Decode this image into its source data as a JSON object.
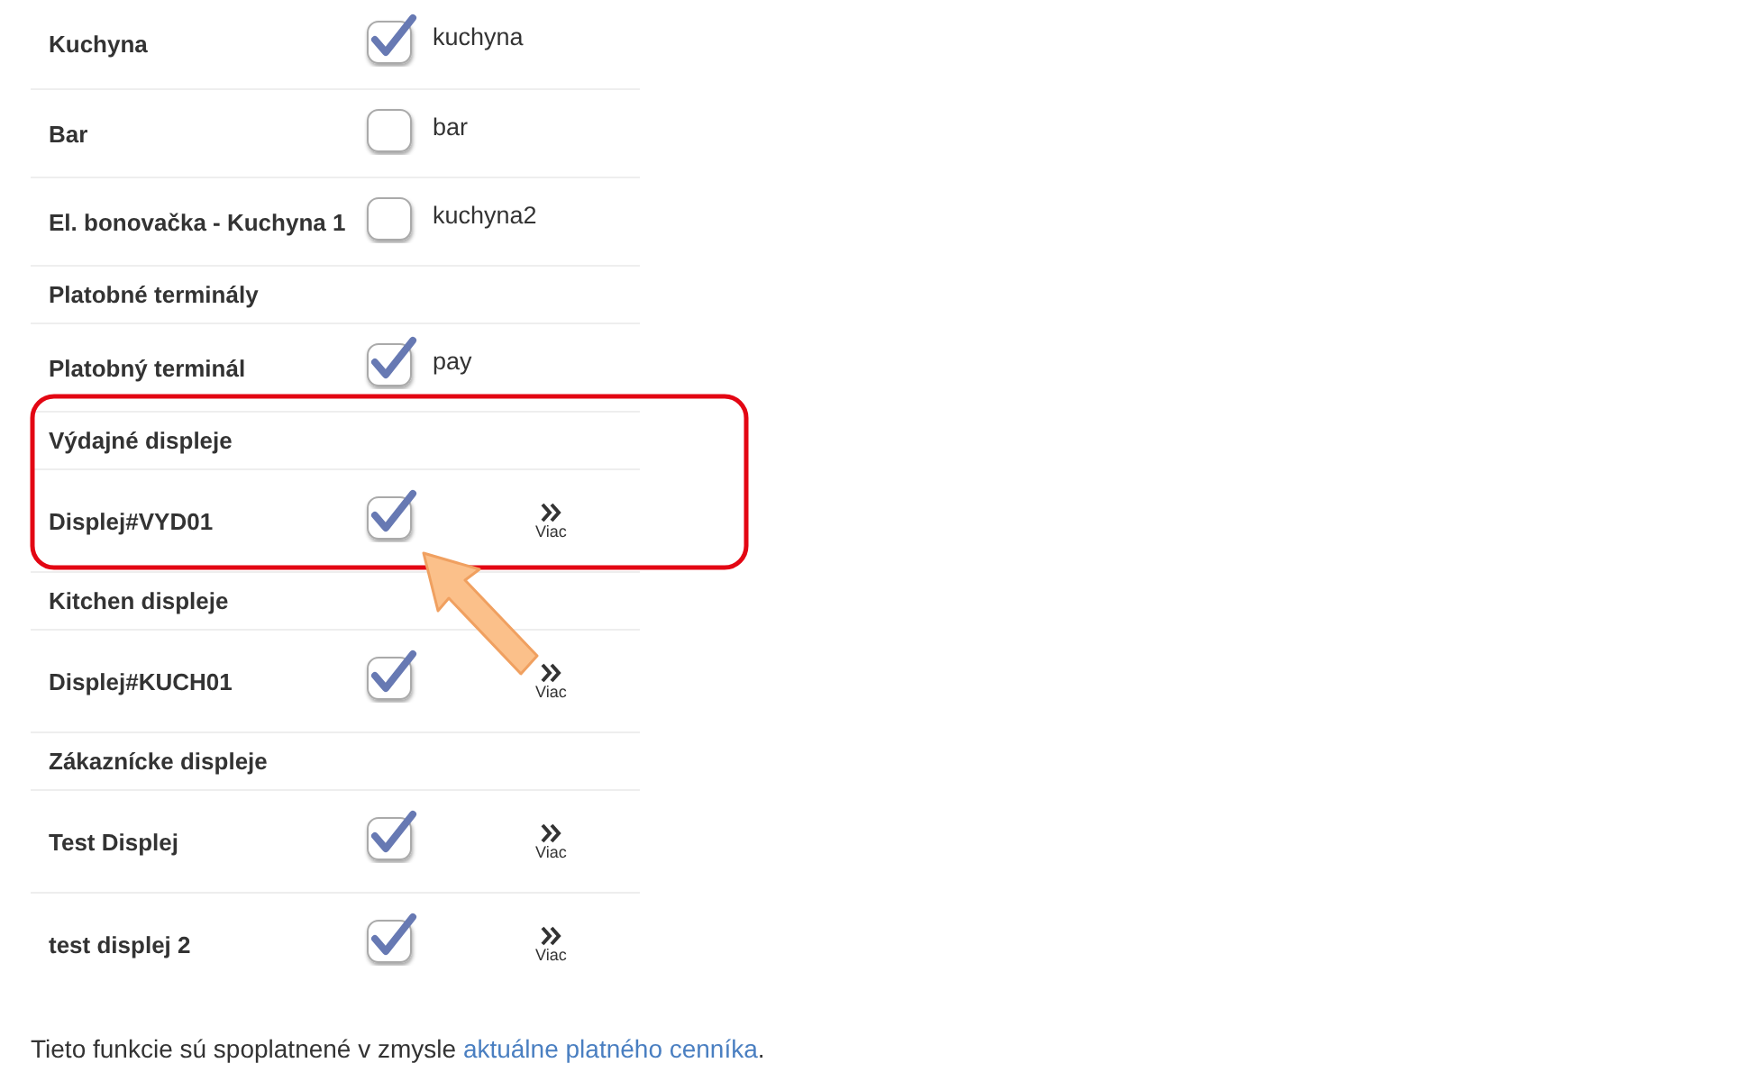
{
  "rows": [
    {
      "kind": "device",
      "label": "Kuchyna",
      "checked": true,
      "value": "kuchyna"
    },
    {
      "kind": "device",
      "label": "Bar",
      "checked": false,
      "value": "bar"
    },
    {
      "kind": "device",
      "label": "El. bonovačka - Kuchyna 1",
      "checked": false,
      "value": "kuchyna2"
    },
    {
      "kind": "header",
      "label": "Platobné terminály"
    },
    {
      "kind": "device",
      "label": "Platobný terminál",
      "checked": true,
      "value": "pay"
    },
    {
      "kind": "header",
      "label": "Výdajné displeje"
    },
    {
      "kind": "device",
      "label": "Displej#VYD01",
      "checked": true,
      "more": "Viac"
    },
    {
      "kind": "header",
      "label": "Kitchen displeje"
    },
    {
      "kind": "device",
      "label": "Displej#KUCH01",
      "checked": true,
      "more": "Viac"
    },
    {
      "kind": "header",
      "label": "Zákaznícke displeje"
    },
    {
      "kind": "device",
      "label": "Test Displej",
      "checked": true,
      "more": "Viac"
    },
    {
      "kind": "device",
      "label": "test displej 2",
      "checked": true,
      "more": "Viac"
    }
  ],
  "footer": {
    "text": "Tieto funkcie sú spoplatnené v zmysle ",
    "link": "aktuálne platného cenníka",
    "end": "."
  }
}
